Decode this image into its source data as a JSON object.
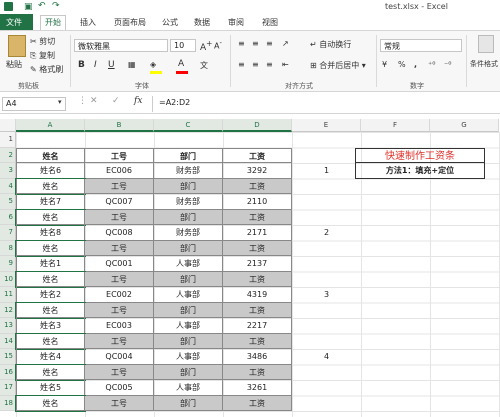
{
  "window": {
    "title": "test.xlsx - Excel"
  },
  "tabs": [
    "文件",
    "开始",
    "插入",
    "页面布局",
    "公式",
    "数据",
    "审阅",
    "视图"
  ],
  "ribbon": {
    "clipboard": {
      "paste": "粘贴",
      "cut": "剪切",
      "copy": "复制",
      "painter": "格式刷",
      "label": "剪贴板"
    },
    "font": {
      "name": "微软雅黑",
      "size": "10",
      "label": "字体",
      "bold": "B",
      "italic": "I",
      "underline": "U"
    },
    "align": {
      "wrap": "自动换行",
      "merge": "合并后居中",
      "label": "对齐方式"
    },
    "number": {
      "format": "常规",
      "label": "数字",
      "pct": "%",
      "comma": ","
    },
    "styles": {
      "cond": "条件格式"
    }
  },
  "formula": {
    "namebox": "A4",
    "content": "=A2:D2",
    "fx": "fx"
  },
  "columns": [
    "A",
    "B",
    "C",
    "D",
    "E",
    "F",
    "G"
  ],
  "rows": [
    "1",
    "2",
    "3",
    "4",
    "5",
    "6",
    "7",
    "8",
    "9",
    "10",
    "11",
    "12",
    "13",
    "14",
    "15",
    "16",
    "17",
    "18"
  ],
  "table": {
    "headers": [
      "姓名",
      "工号",
      "部门",
      "工资"
    ],
    "rows": [
      [
        "姓名6",
        "EC006",
        "财务部",
        "3292"
      ],
      [
        "姓名",
        "工号",
        "部门",
        "工资"
      ],
      [
        "姓名7",
        "QC007",
        "财务部",
        "2110"
      ],
      [
        "姓名",
        "工号",
        "部门",
        "工资"
      ],
      [
        "姓名8",
        "QC008",
        "财务部",
        "2171"
      ],
      [
        "姓名",
        "工号",
        "部门",
        "工资"
      ],
      [
        "姓名1",
        "QC001",
        "人事部",
        "2137"
      ],
      [
        "姓名",
        "工号",
        "部门",
        "工资"
      ],
      [
        "姓名2",
        "EC002",
        "人事部",
        "4319"
      ],
      [
        "姓名",
        "工号",
        "部门",
        "工资"
      ],
      [
        "姓名3",
        "EC003",
        "人事部",
        "2217"
      ],
      [
        "姓名",
        "工号",
        "部门",
        "工资"
      ],
      [
        "姓名4",
        "QC004",
        "人事部",
        "3486"
      ],
      [
        "姓名",
        "工号",
        "部门",
        "工资"
      ],
      [
        "姓名5",
        "QC005",
        "人事部",
        "3261"
      ],
      [
        "姓名",
        "工号",
        "部门",
        "工资"
      ]
    ]
  },
  "col_e": {
    "r3": "1",
    "r7": "2",
    "r11": "3",
    "r15": "4"
  },
  "title_box": {
    "title": "快速制作工资条",
    "method": "方法1：填充+定位"
  },
  "colors": {
    "accent": "#217346",
    "title_red": "#e0302a"
  }
}
